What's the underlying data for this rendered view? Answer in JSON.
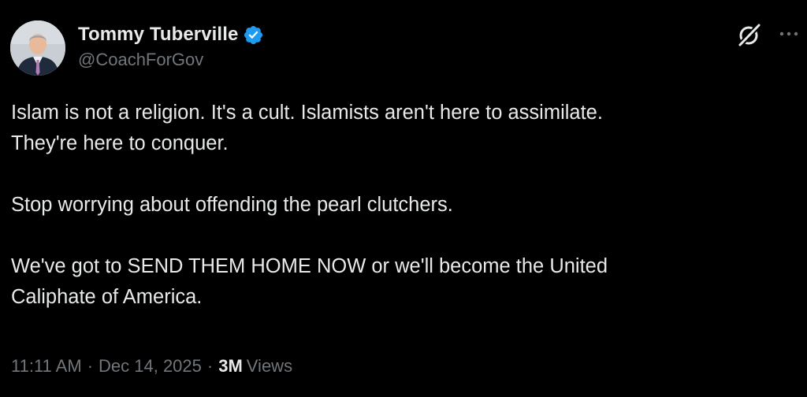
{
  "author": {
    "display_name": "Tommy Tuberville",
    "handle": "@CoachForGov",
    "verified": true,
    "verified_color": "#1d9bf0"
  },
  "tweet": {
    "paragraphs": [
      "Islam is not a religion. It's a cult. Islamists aren't here to assimilate.\nThey're here to conquer.",
      "Stop worrying about offending the pearl clutchers.",
      "We've got to SEND THEM HOME NOW or we'll become the United\nCaliphate of America."
    ]
  },
  "meta": {
    "time": "11:11 AM",
    "separator": "·",
    "date": "Dec 14, 2025",
    "views_count": "3M",
    "views_label": "Views"
  },
  "icons": {
    "header_right": [
      "grok-icon",
      "more-icon"
    ],
    "badge": "verified-badge-icon"
  },
  "colors": {
    "background": "#000000",
    "text_primary": "#e7e9ea",
    "text_secondary": "#71767b"
  }
}
